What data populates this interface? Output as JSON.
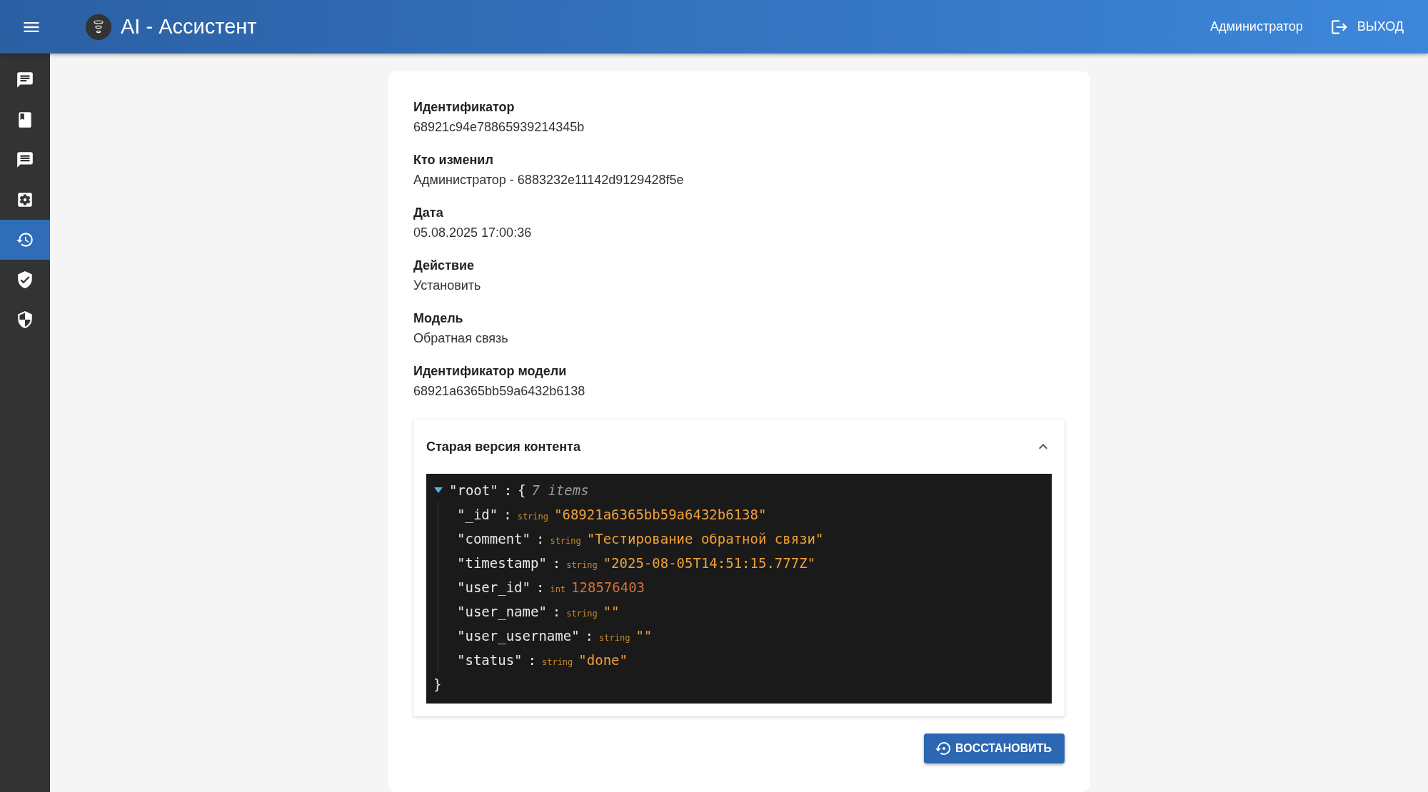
{
  "header": {
    "title": "AI - Ассистент",
    "user": "Администратор",
    "logout": "ВЫХОД"
  },
  "sidebar": {
    "items": [
      {
        "selected": false
      },
      {
        "selected": false
      },
      {
        "selected": false
      },
      {
        "selected": false
      },
      {
        "selected": true
      },
      {
        "selected": false
      },
      {
        "selected": false
      }
    ]
  },
  "details": [
    {
      "label": "Идентификатор",
      "value": "68921c94e78865939214345b"
    },
    {
      "label": "Кто изменил",
      "value": "Администратор - 6883232e11142d9129428f5e"
    },
    {
      "label": "Дата",
      "value": "05.08.2025 17:00:36"
    },
    {
      "label": "Действие",
      "value": "Установить"
    },
    {
      "label": "Модель",
      "value": "Обратная связь"
    },
    {
      "label": "Идентификатор модели",
      "value": "68921a6365bb59a6432b6138"
    }
  ],
  "accordion": {
    "title": "Старая версия контента",
    "expanded": true,
    "json": {
      "root_key": "\"root\"",
      "colon": ":",
      "open": "{",
      "count": "7 items",
      "close": "}",
      "expanded": true,
      "rows": [
        {
          "key": "\"_id\"",
          "colon": ":",
          "type": "string",
          "kind": "string",
          "value": "\"68921a6365bb59a6432b6138\""
        },
        {
          "key": "\"comment\"",
          "colon": ":",
          "type": "string",
          "kind": "string",
          "value": "\"Тестирование обратной связи\""
        },
        {
          "key": "\"timestamp\"",
          "colon": ":",
          "type": "string",
          "kind": "string",
          "value": "\"2025-08-05T14:51:15.777Z\""
        },
        {
          "key": "\"user_id\"",
          "colon": ":",
          "type": "int",
          "kind": "int",
          "value": "128576403"
        },
        {
          "key": "\"user_name\"",
          "colon": ":",
          "type": "string",
          "kind": "string",
          "value": "\"\""
        },
        {
          "key": "\"user_username\"",
          "colon": ":",
          "type": "string",
          "kind": "string",
          "value": "\"\""
        },
        {
          "key": "\"status\"",
          "colon": ":",
          "type": "string",
          "kind": "string",
          "value": "\"done\""
        }
      ]
    }
  },
  "restore_button": "ВОССТАНОВИТЬ"
}
